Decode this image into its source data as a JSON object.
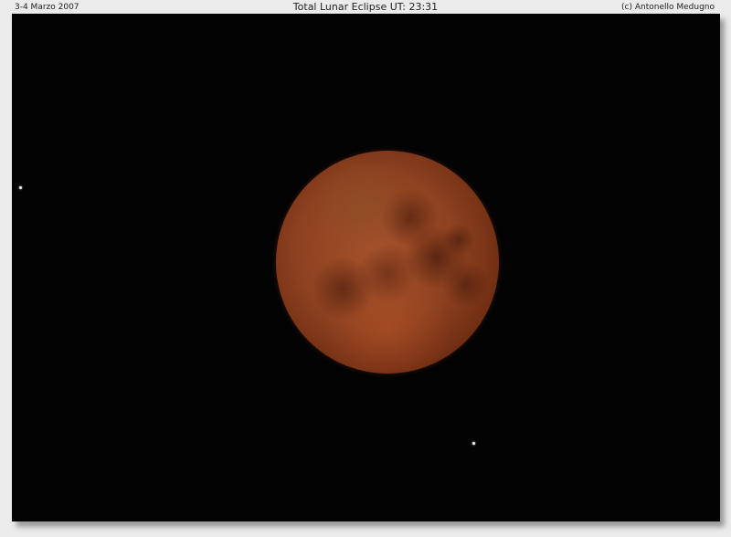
{
  "caption": {
    "date": "3-4 Marzo 2007",
    "title": "Total Lunar Eclipse   UT: 23:31",
    "credit": "(c) Antonello Medugno"
  },
  "photo": {
    "subject": "eclipsed-moon",
    "colors": {
      "sky": "#030303",
      "moon_core": "#a4512a",
      "moon_edge": "#4a1a08",
      "border": "#ebebeb"
    }
  }
}
